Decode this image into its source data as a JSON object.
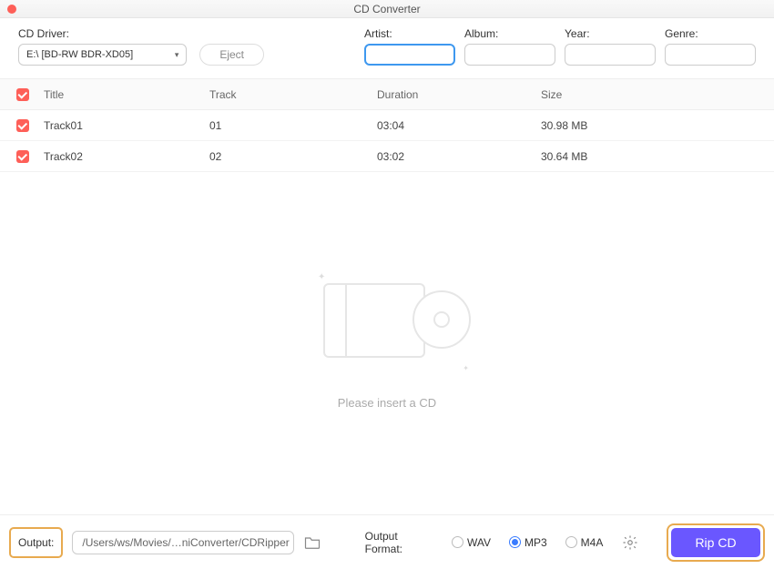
{
  "titlebar": {
    "title": "CD Converter"
  },
  "labels": {
    "cd_driver": "CD Driver:",
    "artist": "Artist:",
    "album": "Album:",
    "year": "Year:",
    "genre": "Genre:",
    "eject": "Eject",
    "output": "Output:",
    "output_format": "Output Format:"
  },
  "driver": {
    "value": "E:\\ [BD-RW   BDR-XD05]"
  },
  "meta": {
    "artist": "",
    "album": "",
    "year": "",
    "genre": ""
  },
  "table": {
    "headers": {
      "title": "Title",
      "track": "Track",
      "duration": "Duration",
      "size": "Size"
    },
    "rows": [
      {
        "checked": true,
        "title": "Track01",
        "track": "01",
        "duration": "03:04",
        "size": "30.98 MB"
      },
      {
        "checked": true,
        "title": "Track02",
        "track": "02",
        "duration": "03:02",
        "size": "30.64 MB"
      }
    ]
  },
  "empty": {
    "message": "Please insert a CD"
  },
  "output": {
    "path": "/Users/ws/Movies/…niConverter/CDRipper"
  },
  "format": {
    "options": [
      "WAV",
      "MP3",
      "M4A"
    ],
    "selected": "MP3"
  },
  "rip_button": "Rip CD"
}
